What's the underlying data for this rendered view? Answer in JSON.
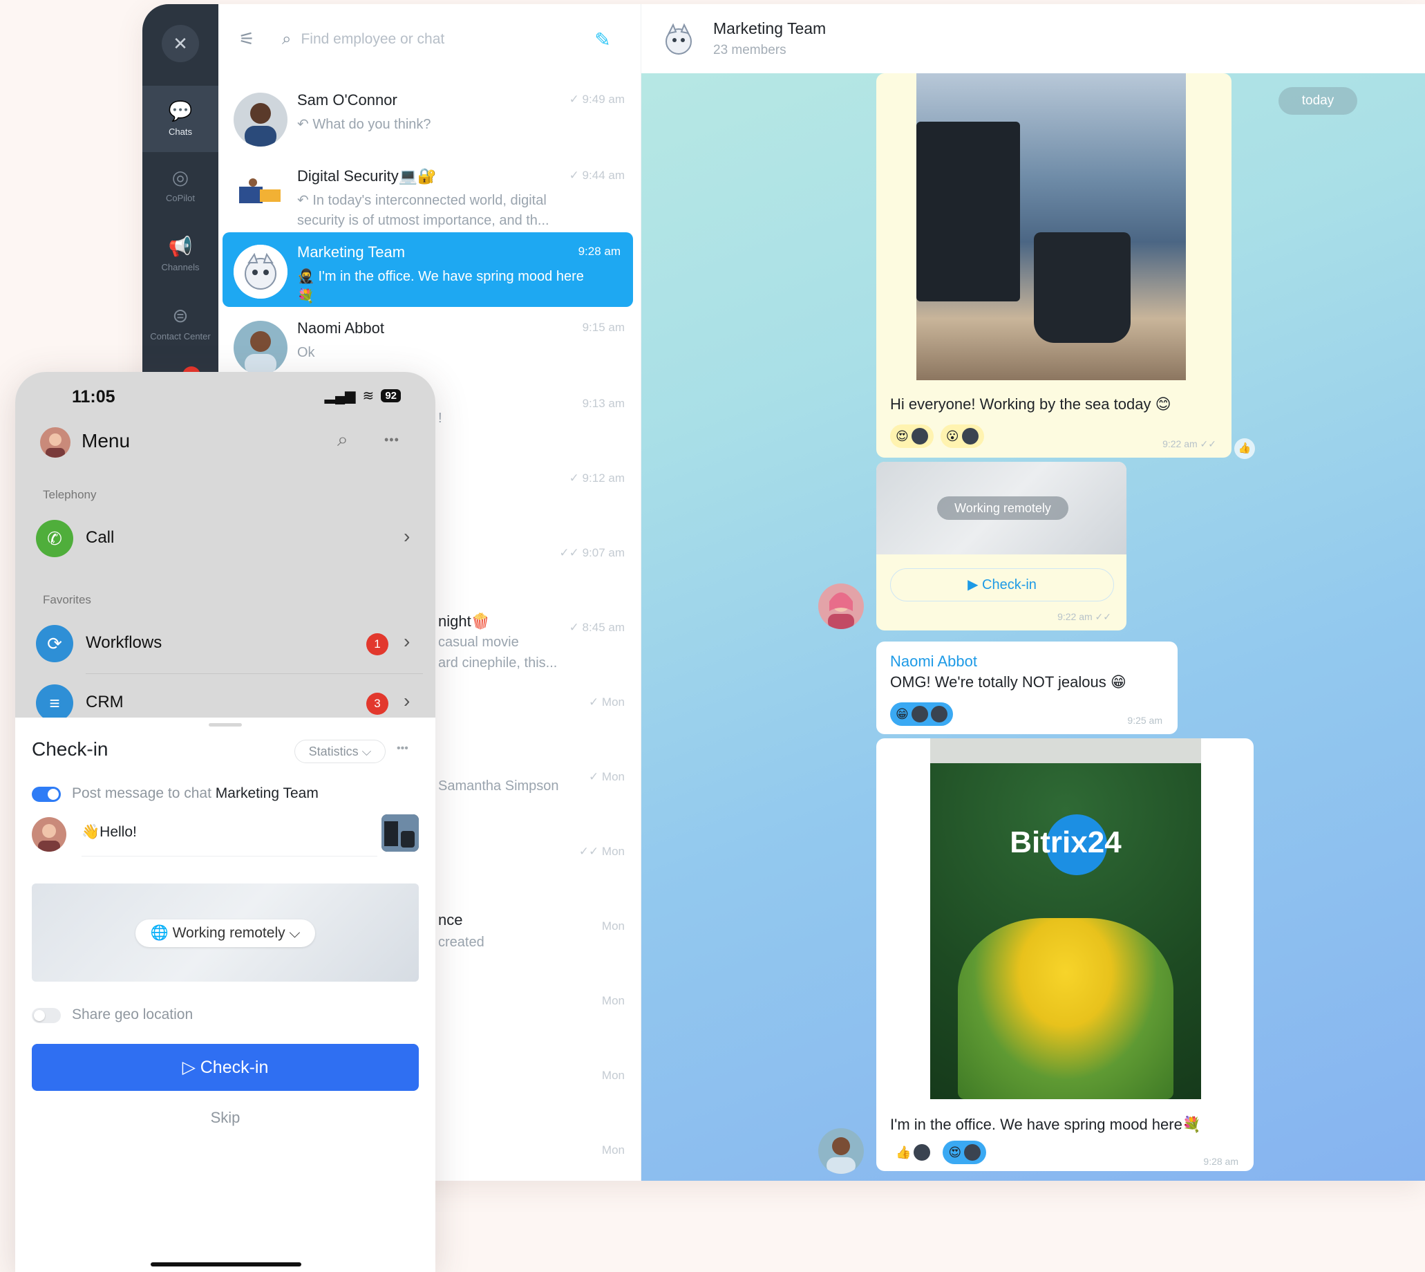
{
  "rail": {
    "items": [
      {
        "label": "Chats",
        "icon": "chats-icon"
      },
      {
        "label": "CoPilot",
        "icon": "copilot-icon"
      },
      {
        "label": "Channels",
        "icon": "megaphone-icon"
      },
      {
        "label": "Contact Center",
        "icon": "contact-center-icon"
      }
    ],
    "badge": "4"
  },
  "search": {
    "placeholder": "Find employee or chat"
  },
  "chats": [
    {
      "name": "Sam O'Connor",
      "preview": "↶ What do you think?",
      "time": "✓ 9:49 am"
    },
    {
      "name": "Digital Security💻🔐",
      "preview": "↶ In today's interconnected world, digital security is of utmost importance, and th...",
      "time": "✓ 9:44 am"
    },
    {
      "name": "Marketing Team",
      "preview": "🥷 I'm in the office. We have spring mood here💐",
      "time": "9:28 am"
    },
    {
      "name": "Naomi Abbot",
      "preview": "Ok",
      "time": "9:15 am"
    }
  ],
  "partial_rows": [
    {
      "time": "9:13 am",
      "frag_a": "!",
      "frag_b": ""
    },
    {
      "time": "✓ 9:12 am",
      "frag_a": "",
      "frag_b": ""
    },
    {
      "time": "✓✓ 9:07 am",
      "frag_a": "",
      "frag_b": ""
    },
    {
      "time": "✓ 8:45 am",
      "frag_a": "night🍿",
      "frag_b": "casual movie"
    },
    {
      "time": "✓ Mon",
      "frag_a": "ard cinephile, this...",
      "frag_b": ""
    },
    {
      "time": "✓ Mon",
      "frag_a": "Samantha Simpson",
      "frag_b": ""
    },
    {
      "time": "✓✓ Mon",
      "frag_a": "",
      "frag_b": ""
    },
    {
      "time": "Mon",
      "frag_a": "nce",
      "frag_b": "created"
    },
    {
      "time": "Mon",
      "frag_a": "",
      "frag_b": ""
    },
    {
      "time": "Mon",
      "frag_a": "",
      "frag_b": ""
    },
    {
      "time": "Mon",
      "frag_a": "",
      "frag_b": ""
    }
  ],
  "chat_panel": {
    "title": "Marketing Team",
    "members": "23 members",
    "date_pill": "today",
    "messages": {
      "sea": {
        "text": "Hi everyone! Working by the sea today 😊",
        "time": "9:22 am ✓✓"
      },
      "checkin": {
        "status": "Working remotely",
        "button": "▶ Check-in",
        "time": "9:22 am ✓✓"
      },
      "naomi": {
        "author": "Naomi Abbot",
        "text": "OMG! We're totally NOT jealous 😁",
        "time": "9:25 am"
      },
      "office": {
        "text": "I'm in the office. We have spring mood here💐",
        "time": "9:28 am",
        "sign": "Bitrix24"
      }
    },
    "reactions": {
      "sea": [
        "😍",
        "😮"
      ],
      "naomi": [
        "😁"
      ],
      "office": [
        "👍",
        "😍"
      ]
    }
  },
  "phone": {
    "status": {
      "time": "11:05",
      "battery": "92"
    },
    "menu_title": "Menu",
    "sections": {
      "telephony": "Telephony",
      "favorites": "Favorites"
    },
    "items": [
      {
        "label": "Call",
        "badge": ""
      },
      {
        "label": "Workflows",
        "badge": "1"
      },
      {
        "label": "CRM",
        "badge": "3"
      }
    ],
    "sheet": {
      "title": "Check-in",
      "statistics": "Statistics ⌵",
      "post_prefix": "Post message to chat",
      "post_chat": "Marketing Team",
      "message": "👋Hello!",
      "status": "🌐 Working remotely ⌵",
      "geo": "Share geo location",
      "button": "▷ Check-in",
      "skip": "Skip"
    }
  },
  "colors": {
    "accent": "#1ea8f2",
    "primary_button": "#2f6ff2",
    "rail": "#2c3540",
    "badge": "#e2382d",
    "call_green": "#4fae3b",
    "workflow_blue": "#2e8fd6"
  }
}
